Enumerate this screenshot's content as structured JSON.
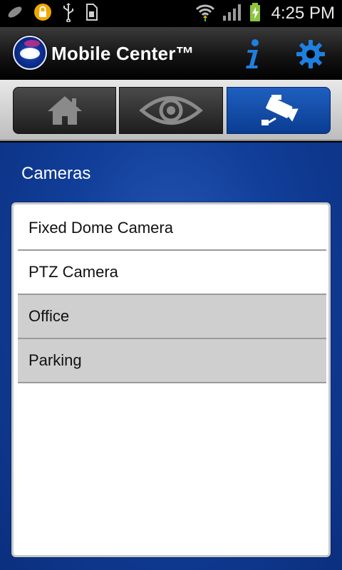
{
  "status_bar": {
    "time": "4:25 PM",
    "left_icons": [
      "missed-call-icon",
      "lock-notification-icon",
      "usb-icon",
      "sd-card-icon"
    ],
    "right_icons": [
      "wifi-icon",
      "signal-icon",
      "battery-charging-icon"
    ]
  },
  "header": {
    "title": "Mobile Center™",
    "info_icon": "info-icon",
    "settings_icon": "gear-icon"
  },
  "tabs": [
    {
      "icon": "home-icon",
      "active": false
    },
    {
      "icon": "eye-icon",
      "active": false
    },
    {
      "icon": "camera-icon",
      "active": true
    }
  ],
  "main": {
    "section_title": "Cameras",
    "cameras": [
      {
        "label": "Fixed Dome Camera",
        "highlighted": false
      },
      {
        "label": "PTZ Camera",
        "highlighted": false
      },
      {
        "label": "Office",
        "highlighted": true
      },
      {
        "label": "Parking",
        "highlighted": true
      }
    ]
  },
  "colors": {
    "accent_blue": "#0a3c92",
    "background_blue": "#113f9a",
    "row_grey": "#cfcfcf"
  }
}
